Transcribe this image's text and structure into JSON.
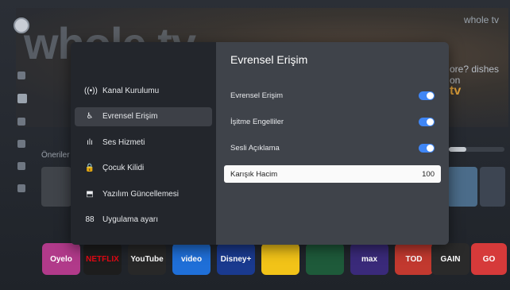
{
  "background": {
    "hero_word": "whole tv",
    "brand": "whole tv",
    "promo_text": "ore? dishes on",
    "promo_tv": "tv",
    "section_label": "Öneriler",
    "apps": [
      "Oyelo",
      "NETFLIX",
      "YouTube",
      "video",
      "Disney+",
      "",
      "",
      "max",
      "TOD",
      "GAIN",
      "GO"
    ]
  },
  "menu": {
    "items": [
      {
        "icon": "antenna-icon",
        "glyph": "((•))",
        "label": "Kanal Kurulumu"
      },
      {
        "icon": "accessibility-icon",
        "glyph": "♿",
        "label": "Evrensel Erişim"
      },
      {
        "icon": "sound-icon",
        "glyph": "ılı",
        "label": "Ses Hizmeti"
      },
      {
        "icon": "lock-icon",
        "glyph": "🔒",
        "label": "Çocuk Kilidi"
      },
      {
        "icon": "update-icon",
        "glyph": "⬒",
        "label": "Yazılım Güncellemesi"
      },
      {
        "icon": "apps-icon",
        "glyph": "88",
        "label": "Uygulama ayarı"
      }
    ],
    "selected_index": 1
  },
  "panel": {
    "title": "Evrensel Erişim",
    "options": [
      {
        "label": "Evrensel Erişim",
        "type": "toggle",
        "state": "on"
      },
      {
        "label": "İşitme Engelliler",
        "type": "toggle",
        "state": "on"
      },
      {
        "label": "Sesli Açıklama",
        "type": "toggle",
        "state": "on"
      },
      {
        "label": "Karışık Hacim",
        "type": "value",
        "value": "100"
      }
    ]
  },
  "colors": {
    "toggle_on": "#3f86f5",
    "dialog_left_bg": "#23262c",
    "dialog_right_bg": "#3f434a",
    "focus_bg": "#fafafa"
  }
}
